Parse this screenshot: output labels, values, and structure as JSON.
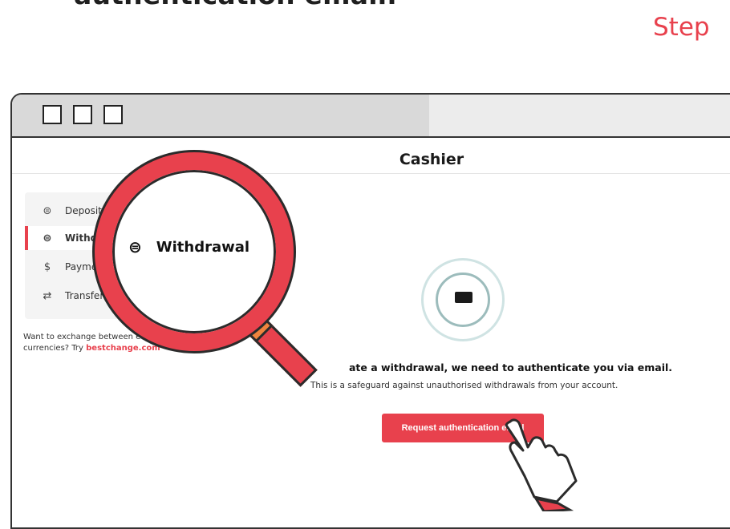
{
  "headline": "authentication email.",
  "step_label": "Step",
  "page": {
    "title": "Cashier"
  },
  "menu": {
    "items": [
      {
        "label": "Deposit",
        "icon": "wallet-deposit-icon"
      },
      {
        "label": "Withdra",
        "icon": "wallet-withdraw-icon",
        "active": true
      },
      {
        "label": "Paymen",
        "icon": "payment-icon"
      },
      {
        "label": "Transfer",
        "icon": "transfer-icon"
      }
    ]
  },
  "exchange": {
    "text": "Want to exchange between e-wallet currencies? Try",
    "link": "bestchange.com"
  },
  "magnifier": {
    "label": "Withdrawal"
  },
  "auth": {
    "message": "ate a withdrawal, we need to authenticate you via email.",
    "subtext": "This is a safeguard against unauthorised withdrawals from your account.",
    "button": "Request authentication email"
  },
  "colors": {
    "accent": "#e8414d",
    "collar": "#f0843e",
    "ring": "#cfe3e3"
  }
}
